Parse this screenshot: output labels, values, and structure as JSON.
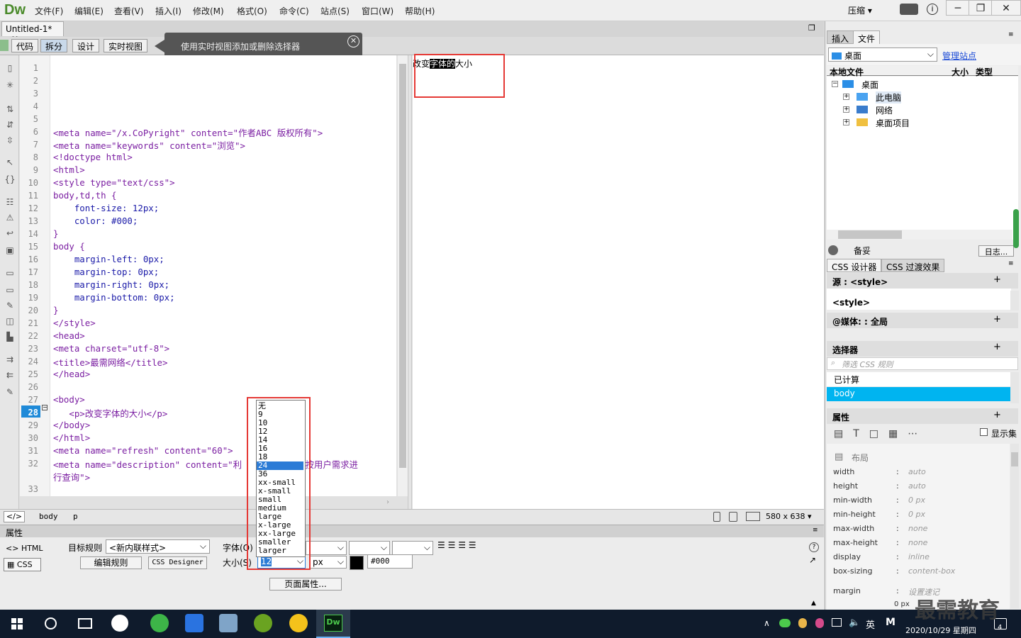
{
  "app": {
    "logo": "Dw",
    "compact": "压缩 ▾"
  },
  "menu": [
    "文件(F)",
    "编辑(E)",
    "查看(V)",
    "插入(I)",
    "修改(M)",
    "格式(O)",
    "命令(C)",
    "站点(S)",
    "窗口(W)",
    "帮助(H)"
  ],
  "document": {
    "tab": "Untitled-1*"
  },
  "views": {
    "code": "代码",
    "split": "拆分",
    "design": "设计",
    "live": "实时视图"
  },
  "tooltip": "使用实时视图添加或删除选择器",
  "code_lines": [
    {
      "n": "1",
      "t": ""
    },
    {
      "n": "2",
      "t": ""
    },
    {
      "n": "3",
      "t": ""
    },
    {
      "n": "4",
      "t": ""
    },
    {
      "n": "5",
      "t": ""
    },
    {
      "n": "6",
      "t": "<meta name=\"/x.CoPyright\" content=\"作者ABC 版权所有\">"
    },
    {
      "n": "7",
      "t": "<meta name=\"keywords\" content=\"浏览\">"
    },
    {
      "n": "8",
      "t": "<!doctype html>"
    },
    {
      "n": "9",
      "t": "<html>"
    },
    {
      "n": "10",
      "t": "<style type=\"text/css\">"
    },
    {
      "n": "11",
      "t": "body,td,th {"
    },
    {
      "n": "12",
      "t": "    font-size: 12px;"
    },
    {
      "n": "13",
      "t": "    color: #000;"
    },
    {
      "n": "14",
      "t": "}"
    },
    {
      "n": "15",
      "t": "body {"
    },
    {
      "n": "16",
      "t": "    margin-left: 0px;"
    },
    {
      "n": "17",
      "t": "    margin-top: 0px;"
    },
    {
      "n": "18",
      "t": "    margin-right: 0px;"
    },
    {
      "n": "19",
      "t": "    margin-bottom: 0px;"
    },
    {
      "n": "20",
      "t": "}"
    },
    {
      "n": "21",
      "t": "</style>"
    },
    {
      "n": "22",
      "t": "<head>"
    },
    {
      "n": "23",
      "t": "<meta charset=\"utf-8\">"
    },
    {
      "n": "24",
      "t": "<title>最需网络</title>"
    },
    {
      "n": "25",
      "t": "</head>"
    },
    {
      "n": "26",
      "t": ""
    },
    {
      "n": "27",
      "t": "<body>"
    },
    {
      "n": "28",
      "t": "   <p>改变字体的大小</p>"
    },
    {
      "n": "29",
      "t": "</body>"
    },
    {
      "n": "30",
      "t": "</html>"
    },
    {
      "n": "31",
      "t": "<meta name=\"refresh\" content=\"60\">"
    },
    {
      "n": "32",
      "t": "<meta name=\"description\" content=\"利            按用户需求进"
    },
    {
      "n": "",
      "t": "行查询\">"
    },
    {
      "n": "33",
      "t": ""
    }
  ],
  "design_text": {
    "before": "改变",
    "selected": "字体的",
    "after": "大小"
  },
  "status": {
    "tags": [
      "body",
      "p"
    ],
    "size": "580 x 638 ▾"
  },
  "properties": {
    "header": "属性",
    "html_btn": "HTML",
    "css_btn": "CSS",
    "target_rule_label": "目标规则",
    "target_rule_value": "<新内联样式>",
    "edit_rule": "编辑规则",
    "css_designer": "CSS Designer",
    "font_label": "字体(O)",
    "size_label": "大小(S)",
    "size_value": "12",
    "unit": "px",
    "color_value": "#000",
    "page_props": "页面属性..."
  },
  "size_options": [
    "无",
    "9",
    "10",
    "12",
    "14",
    "16",
    "18",
    "24",
    "36",
    "xx-small",
    "x-small",
    "small",
    "medium",
    "large",
    "x-large",
    "xx-large",
    "smaller",
    "larger"
  ],
  "size_highlight": "24",
  "right_panel": {
    "tabs": [
      "插入",
      "文件"
    ],
    "location": "桌面",
    "manage_site": "管理站点",
    "cols": [
      "本地文件",
      "大小",
      "类型"
    ],
    "tree": [
      {
        "label": "桌面",
        "level": 0
      },
      {
        "label": "此电脑",
        "level": 1
      },
      {
        "label": "网络",
        "level": 1
      },
      {
        "label": "桌面项目",
        "level": 1
      }
    ],
    "footer": {
      "label": "备妥",
      "log": "日志..."
    },
    "css_tabs": [
      "CSS 设计器",
      "CSS 过渡效果"
    ],
    "source_label": "源 : <style>",
    "source_item": "<style>",
    "media_label": "@媒体: : 全局",
    "selector_label": "选择器",
    "filter_placeholder": "筛选 CSS 规则",
    "computed": "已计算",
    "selected_rule": "body",
    "props_label": "属性",
    "show_set": "显示集",
    "layout_label": "布局",
    "css_props": [
      {
        "name": "width",
        "value": "auto"
      },
      {
        "name": "height",
        "value": "auto"
      },
      {
        "name": "min-width",
        "value": "0 px"
      },
      {
        "name": "min-height",
        "value": "0 px"
      },
      {
        "name": "max-width",
        "value": "none"
      },
      {
        "name": "max-height",
        "value": "none"
      },
      {
        "name": "display",
        "value": "inline"
      },
      {
        "name": "box-sizing",
        "value": "content-box"
      },
      {
        "name": "margin",
        "value": "设置速记"
      }
    ],
    "margin_val": "0 px"
  },
  "taskbar": {
    "lang": "英",
    "ime": "M",
    "datetime": "2020/10/29 星期四",
    "notif": "4",
    "watermark": "最需教育"
  }
}
